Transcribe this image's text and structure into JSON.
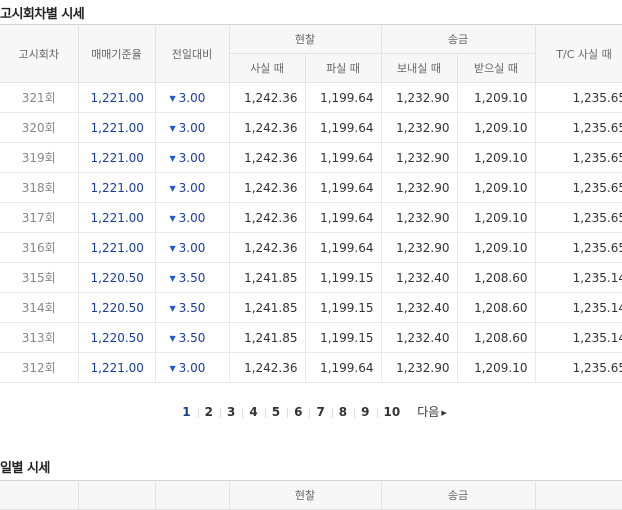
{
  "section_round": {
    "title": "고시회차별 시세"
  },
  "section_daily": {
    "title": "일별 시세"
  },
  "headers": {
    "round": "고시회차",
    "base_rate": "매매기준율",
    "change": "전일대비",
    "cash": "현찰",
    "remit": "송금",
    "tc": "T/C 사실 때",
    "cash_buy": "사실 때",
    "cash_sell": "파실 때",
    "remit_send": "보내실 때",
    "remit_receive": "받으실 때"
  },
  "rows": [
    {
      "round": "321회",
      "base": "1,221.00",
      "dir": "down",
      "change": "3.00",
      "cash_buy": "1,242.36",
      "cash_sell": "1,199.64",
      "send": "1,232.90",
      "receive": "1,209.10",
      "tc": "1,235.65"
    },
    {
      "round": "320회",
      "base": "1,221.00",
      "dir": "down",
      "change": "3.00",
      "cash_buy": "1,242.36",
      "cash_sell": "1,199.64",
      "send": "1,232.90",
      "receive": "1,209.10",
      "tc": "1,235.65"
    },
    {
      "round": "319회",
      "base": "1,221.00",
      "dir": "down",
      "change": "3.00",
      "cash_buy": "1,242.36",
      "cash_sell": "1,199.64",
      "send": "1,232.90",
      "receive": "1,209.10",
      "tc": "1,235.65"
    },
    {
      "round": "318회",
      "base": "1,221.00",
      "dir": "down",
      "change": "3.00",
      "cash_buy": "1,242.36",
      "cash_sell": "1,199.64",
      "send": "1,232.90",
      "receive": "1,209.10",
      "tc": "1,235.65"
    },
    {
      "round": "317회",
      "base": "1,221.00",
      "dir": "down",
      "change": "3.00",
      "cash_buy": "1,242.36",
      "cash_sell": "1,199.64",
      "send": "1,232.90",
      "receive": "1,209.10",
      "tc": "1,235.65"
    },
    {
      "round": "316회",
      "base": "1,221.00",
      "dir": "down",
      "change": "3.00",
      "cash_buy": "1,242.36",
      "cash_sell": "1,199.64",
      "send": "1,232.90",
      "receive": "1,209.10",
      "tc": "1,235.65"
    },
    {
      "round": "315회",
      "base": "1,220.50",
      "dir": "down",
      "change": "3.50",
      "cash_buy": "1,241.85",
      "cash_sell": "1,199.15",
      "send": "1,232.40",
      "receive": "1,208.60",
      "tc": "1,235.14"
    },
    {
      "round": "314회",
      "base": "1,220.50",
      "dir": "down",
      "change": "3.50",
      "cash_buy": "1,241.85",
      "cash_sell": "1,199.15",
      "send": "1,232.40",
      "receive": "1,208.60",
      "tc": "1,235.14"
    },
    {
      "round": "313회",
      "base": "1,220.50",
      "dir": "down",
      "change": "3.50",
      "cash_buy": "1,241.85",
      "cash_sell": "1,199.15",
      "send": "1,232.40",
      "receive": "1,208.60",
      "tc": "1,235.14"
    },
    {
      "round": "312회",
      "base": "1,221.00",
      "dir": "down",
      "change": "3.00",
      "cash_buy": "1,242.36",
      "cash_sell": "1,199.64",
      "send": "1,232.90",
      "receive": "1,209.10",
      "tc": "1,235.65"
    }
  ],
  "pagination": {
    "pages": [
      "1",
      "2",
      "3",
      "4",
      "5",
      "6",
      "7",
      "8",
      "9",
      "10"
    ],
    "current": "1",
    "next_label": "다음",
    "next_icon": "chevron-right-icon"
  },
  "icons": {
    "down": "down-triangle-icon"
  },
  "colors": {
    "link_blue": "#1a3e9a",
    "arrow_blue": "#1a5bd6",
    "header_bg": "#f7f7f7"
  }
}
